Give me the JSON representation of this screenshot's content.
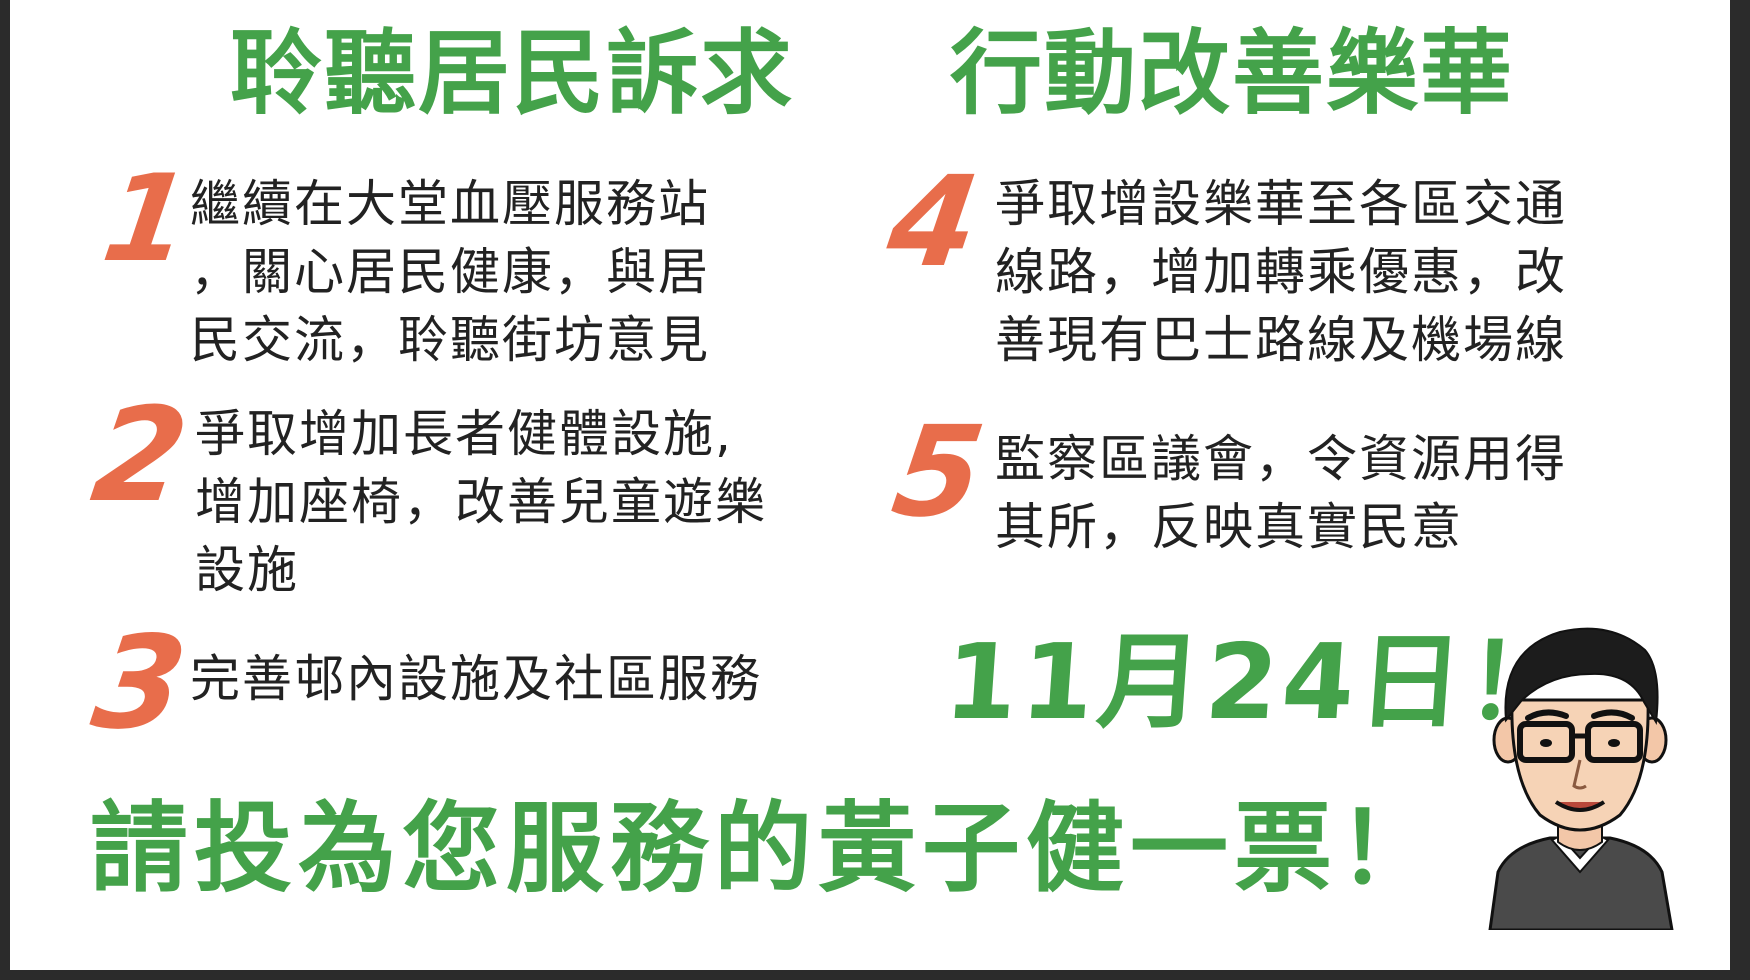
{
  "headline": {
    "left": "聆聽居民訴求",
    "right": "行動改善樂華"
  },
  "items": [
    {
      "number": "1",
      "text": "繼續在大堂血壓服務站\n，關心居民健康，與居\n民交流，聆聽街坊意見"
    },
    {
      "number": "2",
      "text": "爭取增加長者健體設施,\n增加座椅，改善兒童遊樂\n設施"
    },
    {
      "number": "3",
      "text": "完善邨內設施及社區服務"
    },
    {
      "number": "4",
      "text": "爭取增設樂華至各區交通\n線路，增加轉乘優惠，改\n善現有巴士路線及機場線"
    },
    {
      "number": "5",
      "text": "監察區議會，令資源用得\n其所，反映真實民意"
    }
  ],
  "date": "11月24日！",
  "slogan": "請投為您服務的黃子健一票！",
  "colors": {
    "green": "#44a24a",
    "orange": "#e86d4b",
    "text": "#222222"
  }
}
